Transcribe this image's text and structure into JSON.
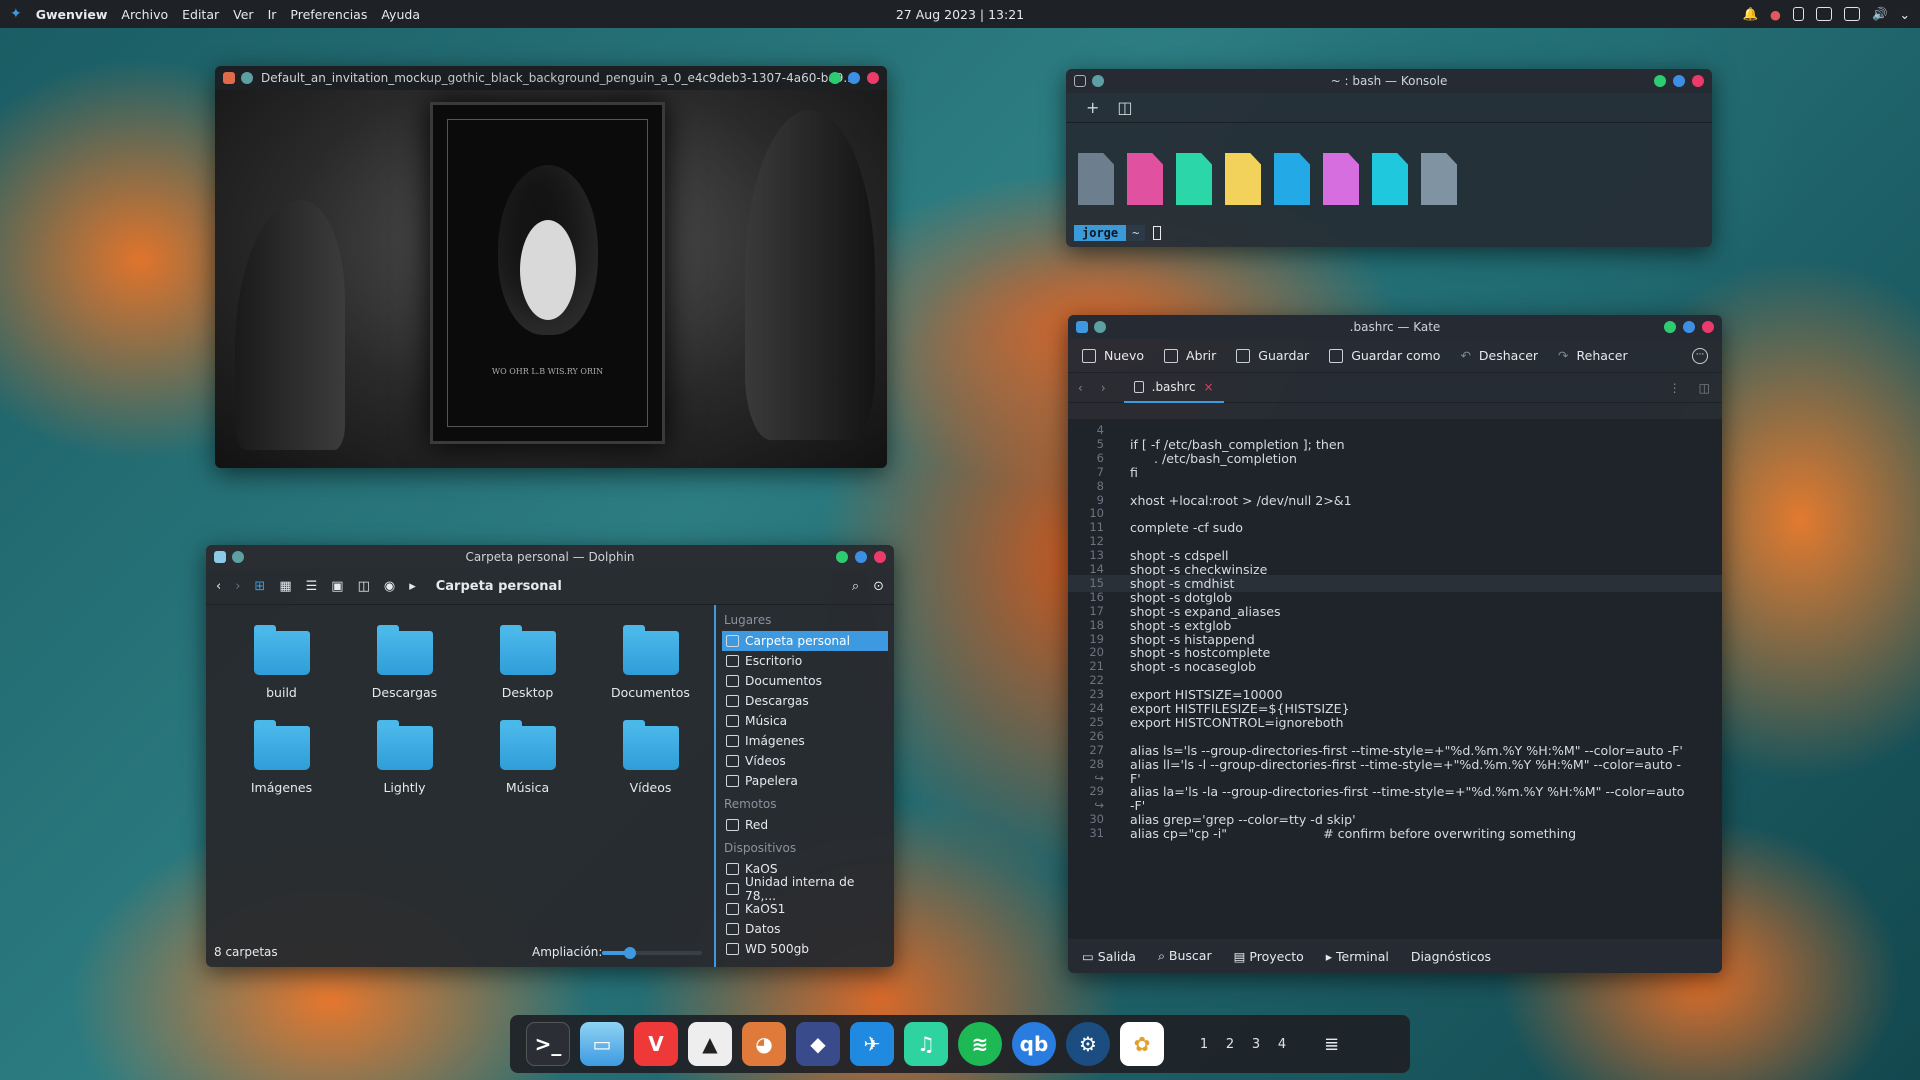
{
  "topbar": {
    "app": "Gwenview",
    "menu": [
      "Archivo",
      "Editar",
      "Ver",
      "Ir",
      "Preferencias",
      "Ayuda"
    ],
    "clock": "27 Aug 2023 | 13:21"
  },
  "gwenview": {
    "title": "Default_an_invitation_mockup_gothic_black_background_penguin_a_0_e4c9deb3-1307-4a60-ba9...",
    "poster_text": "WO OHR L.B WIS.RY ORIN"
  },
  "konsole": {
    "title": "~ : bash — Konsole",
    "user": "jorge",
    "dir": "~",
    "swatch_colors": [
      "#6d7f8e",
      "#e052a0",
      "#2bd6a8",
      "#f2d25a",
      "#22a9e6",
      "#d66ee0",
      "#1fc8dd",
      "#7f93a3"
    ]
  },
  "kate": {
    "title": ".bashrc — Kate",
    "toolbar": {
      "new": "Nuevo",
      "open": "Abrir",
      "save": "Guardar",
      "save_as": "Guardar como",
      "undo": "Deshacer",
      "redo": "Rehacer"
    },
    "tab": ".bashrc",
    "current_line": 15,
    "lines": [
      {
        "n": "4",
        "t": ""
      },
      {
        "n": "5",
        "t": "if [ -f /etc/bash_completion ]; then"
      },
      {
        "n": "6",
        "t": "      . /etc/bash_completion"
      },
      {
        "n": "7",
        "t": "fi"
      },
      {
        "n": "8",
        "t": ""
      },
      {
        "n": "9",
        "t": "xhost +local:root > /dev/null 2>&1"
      },
      {
        "n": "10",
        "t": ""
      },
      {
        "n": "11",
        "t": "complete -cf sudo"
      },
      {
        "n": "12",
        "t": ""
      },
      {
        "n": "13",
        "t": "shopt -s cdspell"
      },
      {
        "n": "14",
        "t": "shopt -s checkwinsize"
      },
      {
        "n": "15",
        "t": "shopt -s cmdhist"
      },
      {
        "n": "16",
        "t": "shopt -s dotglob"
      },
      {
        "n": "17",
        "t": "shopt -s expand_aliases"
      },
      {
        "n": "18",
        "t": "shopt -s extglob"
      },
      {
        "n": "19",
        "t": "shopt -s histappend"
      },
      {
        "n": "20",
        "t": "shopt -s hostcomplete"
      },
      {
        "n": "21",
        "t": "shopt -s nocaseglob"
      },
      {
        "n": "22",
        "t": ""
      },
      {
        "n": "23",
        "t": "export HISTSIZE=10000"
      },
      {
        "n": "24",
        "t": "export HISTFILESIZE=${HISTSIZE}"
      },
      {
        "n": "25",
        "t": "export HISTCONTROL=ignoreboth"
      },
      {
        "n": "26",
        "t": ""
      },
      {
        "n": "27",
        "t": "alias ls='ls --group-directories-first --time-style=+\"%d.%m.%Y %H:%M\" --color=auto -F'"
      },
      {
        "n": "28",
        "t": "alias ll='ls -l --group-directories-first --time-style=+\"%d.%m.%Y %H:%M\" --color=auto -"
      },
      {
        "n": "↪",
        "t": "F'"
      },
      {
        "n": "29",
        "t": "alias la='ls -la --group-directories-first --time-style=+\"%d.%m.%Y %H:%M\" --color=auto"
      },
      {
        "n": "↪",
        "t": "-F'"
      },
      {
        "n": "30",
        "t": "alias grep='grep --color=tty -d skip'"
      },
      {
        "n": "31",
        "t": "alias cp=\"cp -i\"                        # confirm before overwriting something"
      }
    ],
    "bottom": {
      "output": "Salida",
      "search": "Buscar",
      "project": "Proyecto",
      "terminal": "Terminal",
      "diagnostics": "Diagnósticos"
    }
  },
  "dolphin": {
    "title": "Carpeta personal — Dolphin",
    "breadcrumb": "Carpeta personal",
    "folders": [
      "build",
      "Descargas",
      "Desktop",
      "Documentos",
      "Imágenes",
      "Lightly",
      "Música",
      "Vídeos"
    ],
    "status": "8 carpetas",
    "zoom_label": "Ampliación:",
    "zoom_level": 0.28,
    "places_header": "Lugares",
    "places": [
      "Carpeta personal",
      "Escritorio",
      "Documentos",
      "Descargas",
      "Música",
      "Imágenes",
      "Vídeos",
      "Papelera"
    ],
    "remote_header": "Remotos",
    "remote": [
      "Red"
    ],
    "devices_header": "Dispositivos",
    "devices": [
      "KaOS",
      "Unidad interna de 78,...",
      "KaOS1",
      "Datos",
      "WD 500gb"
    ]
  },
  "dock": {
    "desktops": [
      "1",
      "2",
      "3",
      "4"
    ]
  }
}
